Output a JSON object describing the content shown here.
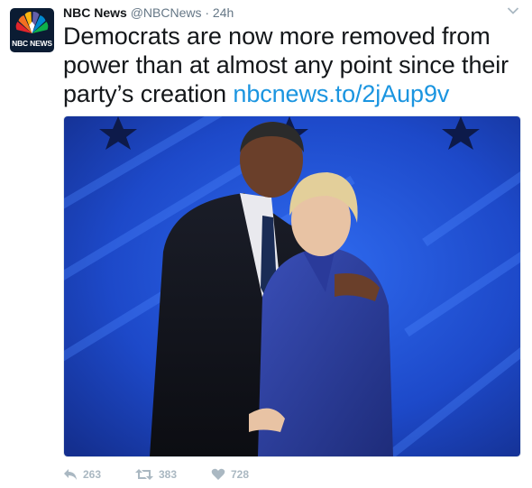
{
  "tweet": {
    "author_name": "NBC News",
    "handle": "@NBCNews",
    "separator": "·",
    "timestamp": "24h",
    "avatar_text": "NBC NEWS",
    "text": "Democrats are now more removed from power than at almost any point since their party’s creation",
    "link": "nbcnews.to/2jAup9v"
  },
  "actions": {
    "reply_count": "263",
    "retweet_count": "383",
    "like_count": "728"
  },
  "colors": {
    "link": "#1b95e0",
    "meta": "#657786",
    "action": "#aab8c2"
  },
  "icons": [
    "nbc-peacock-icon",
    "chevron-down-icon",
    "reply-icon",
    "retweet-icon",
    "heart-icon"
  ]
}
